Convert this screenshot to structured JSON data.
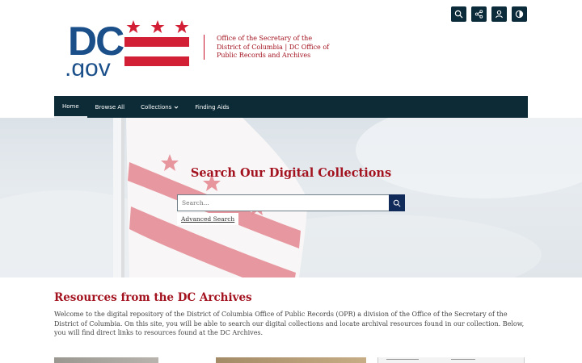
{
  "logo": {
    "text_dc": "DC",
    "text_gov": ".gov"
  },
  "header": {
    "office_name": "Office of the Secretary of the District of Columbia | DC Office of Public Records and Archives"
  },
  "toolbar": {
    "buttons": [
      {
        "name": "search-icon"
      },
      {
        "name": "share-icon"
      },
      {
        "name": "user-icon"
      },
      {
        "name": "contrast-icon"
      }
    ]
  },
  "nav": {
    "items": [
      {
        "label": "Home"
      },
      {
        "label": "Browse All"
      },
      {
        "label": "Collections"
      },
      {
        "label": "Finding Aids"
      }
    ]
  },
  "hero": {
    "title": "Search Our Digital Collections",
    "search_placeholder": "Search...",
    "advanced_search": "Advanced Search"
  },
  "resources": {
    "title": "Resources from the DC Archives",
    "description": "Welcome to the digital repository of the District of Columbia Office of Public Records (OPR) a division of the Office of the Secretary of the District of Columbia. On this site, you will be able to search our digital collections and locate archival resources found in our collection. Below, you will find direct links to resources found at the DC Archives."
  },
  "colors": {
    "brand_red": "#a3121f",
    "flag_red": "#d31f35",
    "logo_blue": "#1a4f8a",
    "nav_bg": "#0c2b36",
    "search_btn": "#102a5a"
  }
}
